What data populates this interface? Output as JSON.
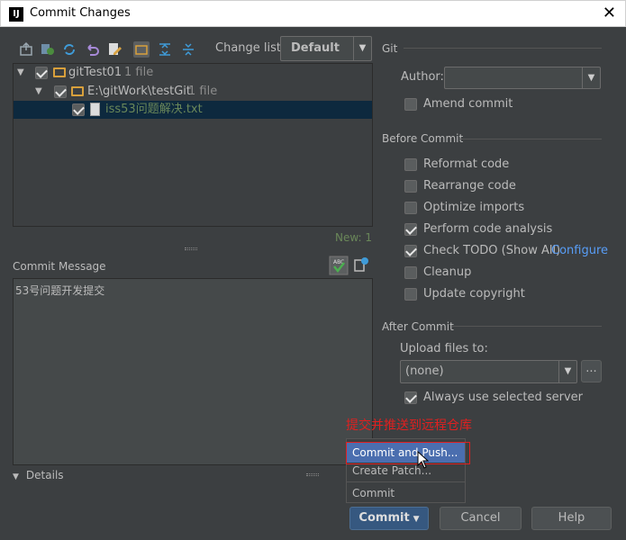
{
  "window": {
    "title": "Commit Changes",
    "close_glyph": "✕",
    "logo_text": "IJ"
  },
  "toolbar": {
    "icons": [
      "commit-diff-icon",
      "refresh-status-icon",
      "refresh-icon",
      "rollback-icon",
      "edit-source-icon",
      "group-by-directory-icon",
      "expand-all-icon",
      "collapse-all-icon"
    ],
    "changelist_label": "Change list:",
    "changelist_value": "Default"
  },
  "tree": {
    "rows": [
      {
        "name": "gitTest01",
        "count": "1 file"
      },
      {
        "name": "E:\\gitWork\\testGit",
        "count": "1 file"
      },
      {
        "name": "iss53问题解决.txt",
        "count": ""
      }
    ],
    "new_count": "New: 1"
  },
  "commit_message": {
    "label": "Commit Message",
    "value": "53号问题开发提交"
  },
  "details_label": "Details",
  "git": {
    "section": "Git",
    "author_label": "Author:",
    "author_value": "",
    "amend_label": "Amend commit"
  },
  "before_commit": {
    "section": "Before Commit",
    "options": [
      {
        "label": "Reformat code",
        "checked": false
      },
      {
        "label": "Rearrange code",
        "checked": false
      },
      {
        "label": "Optimize imports",
        "checked": false
      },
      {
        "label": "Perform code analysis",
        "checked": true
      },
      {
        "label": "Check TODO (Show All)",
        "checked": true
      },
      {
        "label": "Cleanup",
        "checked": false
      },
      {
        "label": "Update copyright",
        "checked": false
      }
    ],
    "configure_link": "Configure"
  },
  "after_commit": {
    "section": "After Commit",
    "upload_label": "Upload files to:",
    "upload_value": "(none)",
    "browse_label": "...",
    "always_label": "Always use selected server"
  },
  "annotation": "提交并推送到远程仓库",
  "popup_menu": {
    "items": [
      "Commit and Push...",
      "Create Patch...",
      "Commit"
    ]
  },
  "buttons": {
    "commit": "Commit",
    "cancel": "Cancel",
    "help": "Help"
  },
  "colors": {
    "background": "#3c3f41",
    "selection": "#0d293e",
    "accent": "#4b6eaf",
    "annotation": "#e02020",
    "new_file": "#6a8759",
    "link": "#589df6"
  }
}
